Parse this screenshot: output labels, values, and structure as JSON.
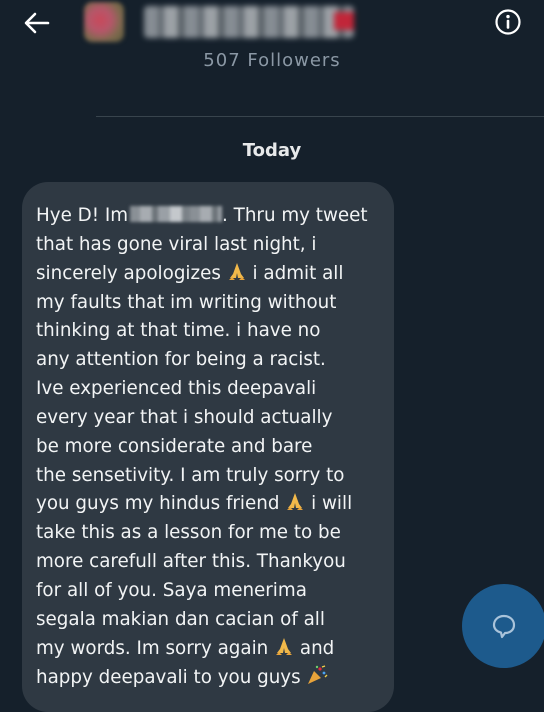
{
  "header": {
    "back_icon": "back-arrow-icon",
    "info_icon": "info-icon",
    "followers": "507 Followers"
  },
  "conversation": {
    "date_separator": "Today"
  },
  "message": {
    "line1_before": "Hye D! Im",
    "line1_after": ". Thru my tweet",
    "lines": [
      "that has gone viral last night, i",
      "sincerely apologizes",
      "i admit all",
      "my faults that im writing without",
      "thinking at that time. i have no",
      "any attention for being a racist.",
      "Ive experienced this deepavali",
      "every year that i should actually",
      "be more considerate and bare",
      "the sensetivity.  I am truly sorry to",
      "you guys my hindus friend",
      "i will",
      "take this as a lesson for me to be",
      "more carefull after this. Thankyou",
      "for all of you. Saya menerima",
      "segala makian dan cacian of all",
      "my words. Im sorry again",
      "and",
      "happy deepavali to you guys"
    ]
  },
  "compose": {
    "icon": "message-bubble-icon"
  },
  "colors": {
    "background": "#15202b",
    "bubble": "#2f3943",
    "fab": "#1d5a8c",
    "muted": "#8b98a5"
  }
}
